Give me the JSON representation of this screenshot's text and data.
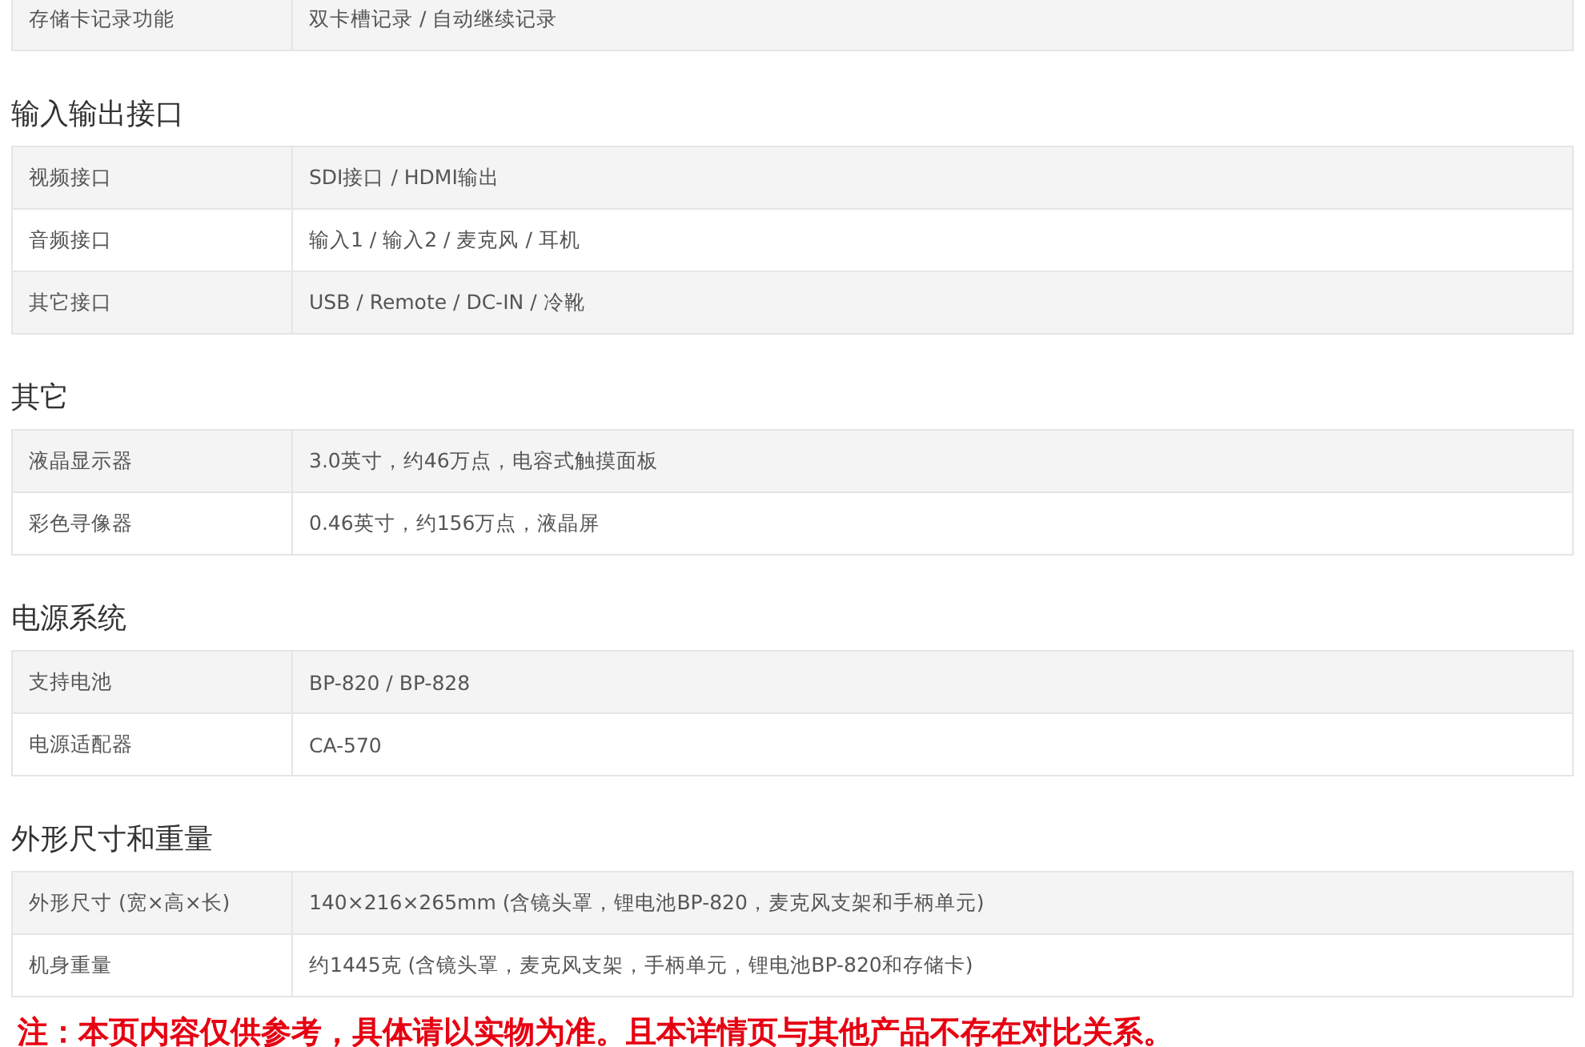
{
  "sections": [
    {
      "rows": [
        {
          "label": "存储卡记录功能",
          "value": "双卡槽记录 / 自动继续记录"
        }
      ]
    },
    {
      "title": "输入输出接口",
      "rows": [
        {
          "label": "视频接口",
          "value": "SDI接口 / HDMI输出"
        },
        {
          "label": "音频接口",
          "value": "输入1 / 输入2 / 麦克风 / 耳机"
        },
        {
          "label": "其它接口",
          "value": "USB / Remote / DC-IN / 冷靴"
        }
      ]
    },
    {
      "title": "其它",
      "rows": [
        {
          "label": "液晶显示器",
          "value": "3.0英寸，约46万点，电容式触摸面板"
        },
        {
          "label": "彩色寻像器",
          "value": "0.46英寸，约156万点，液晶屏"
        }
      ]
    },
    {
      "title": "电源系统",
      "rows": [
        {
          "label": "支持电池",
          "value": "BP-820 / BP-828"
        },
        {
          "label": "电源适配器",
          "value": "CA-570"
        }
      ]
    },
    {
      "title": "外形尺寸和重量",
      "rows": [
        {
          "label": "外形尺寸 (宽×高×长)",
          "value": "140×216×265mm (含镜头罩，锂电池BP-820，麦克风支架和手柄单元)"
        },
        {
          "label": "机身重量",
          "value": "约1445克 (含镜头罩，麦克风支架，手柄单元，锂电池BP-820和存储卡)"
        }
      ]
    }
  ],
  "note": "注：本页内容仅供参考，具体请以实物为准。且本详情页与其他产品不存在对比关系。"
}
